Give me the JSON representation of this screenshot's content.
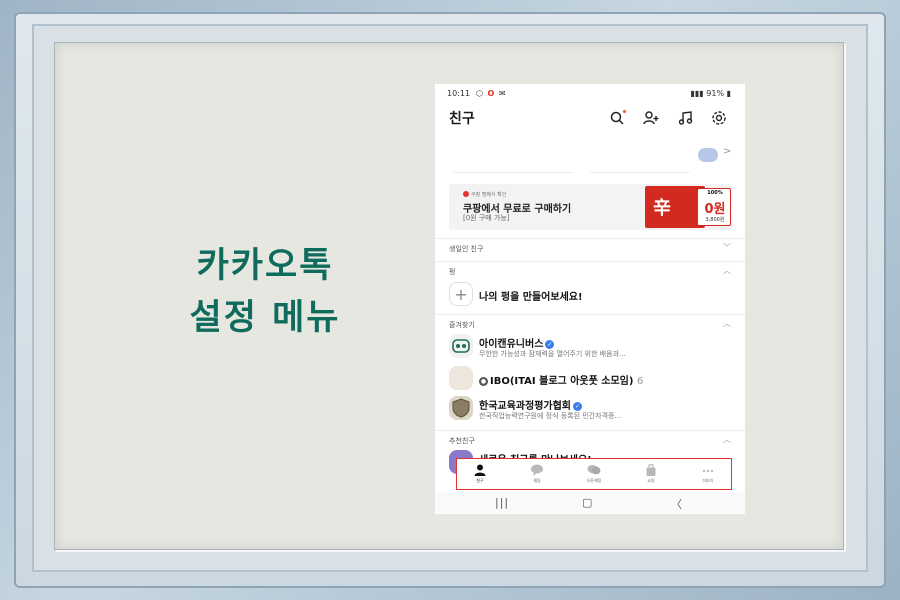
{
  "slide": {
    "title_line1": "카카오톡",
    "title_line2": "설정 메뉴"
  },
  "status_bar": {
    "time": "10:11",
    "battery": "91%"
  },
  "header": {
    "title": "친구",
    "icons": [
      "search-icon",
      "add-friend-icon",
      "music-icon",
      "settings-icon"
    ]
  },
  "ad": {
    "small_label": "쿠팡 캠페서 확인",
    "title": "쿠팡에서 무료로 구매하기",
    "subtitle": "[0원 구매 가능]",
    "product_char": "辛",
    "price_top": "100%",
    "price_main": "0원",
    "price_original": "3,800원"
  },
  "sections": {
    "birthday": "생일인 친구",
    "feed": "펑",
    "favorites": "즐겨찾기",
    "recommended": "추천친구"
  },
  "feed_row": {
    "plus": "+",
    "text": "나의 펑을 만들어보세요!"
  },
  "favorites": [
    {
      "name": "아이캔유니버스",
      "desc": "무한한 가능성과 잠재력을 열어주기 위한 배움과...",
      "verified": true
    },
    {
      "name": "IBO(ITAI 블로그 아웃풋 소모임)",
      "count": "6",
      "desc": "",
      "verified": false
    },
    {
      "name": "한국교육과정평가협회",
      "desc": "한국직업능력연구원에 정식 등록된 민간자격증...",
      "verified": true
    }
  ],
  "recommended_preview": "새로운 친구를 만나보세요!",
  "bottom_nav": [
    {
      "label": "친구",
      "icon": "person-icon",
      "active": true
    },
    {
      "label": "채팅",
      "icon": "chat-icon",
      "active": false
    },
    {
      "label": "오픈채팅",
      "icon": "open-chat-icon",
      "active": false
    },
    {
      "label": "쇼핑",
      "icon": "shopping-icon",
      "active": false
    },
    {
      "label": "더보기",
      "icon": "more-icon",
      "active": false
    }
  ],
  "colors": {
    "title_green": "#0f6b5b",
    "highlight_red": "#e0322f",
    "verified_blue": "#3c7df0"
  }
}
